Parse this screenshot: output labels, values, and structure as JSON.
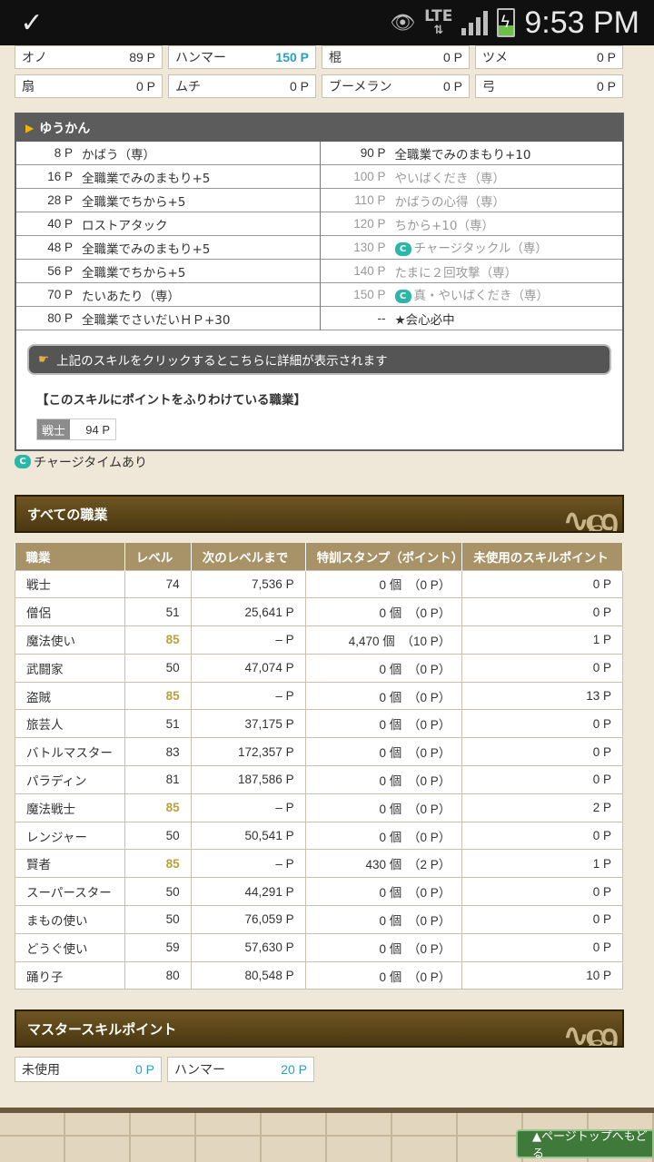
{
  "status_bar": {
    "time": "9:53 PM",
    "network": "LTE"
  },
  "weapons": [
    [
      {
        "name": "オノ",
        "points": "89 P"
      },
      {
        "name": "ハンマー",
        "points": "150 P",
        "highlight": true
      },
      {
        "name": "棍",
        "points": "0 P"
      },
      {
        "name": "ツメ",
        "points": "0 P"
      }
    ],
    [
      {
        "name": "扇",
        "points": "0 P"
      },
      {
        "name": "ムチ",
        "points": "0 P"
      },
      {
        "name": "ブーメラン",
        "points": "0 P"
      },
      {
        "name": "弓",
        "points": "0 P"
      }
    ]
  ],
  "skill_panel": {
    "title": "ゆうかん",
    "left": [
      {
        "p": "8 P",
        "name": "かばう（専）"
      },
      {
        "p": "16 P",
        "name": "全職業でみのまもり+5"
      },
      {
        "p": "28 P",
        "name": "全職業でちから+5"
      },
      {
        "p": "40 P",
        "name": "ロストアタック"
      },
      {
        "p": "48 P",
        "name": "全職業でみのまもり+5"
      },
      {
        "p": "56 P",
        "name": "全職業でちから+5"
      },
      {
        "p": "70 P",
        "name": "たいあたり（専）"
      },
      {
        "p": "80 P",
        "name": "全職業でさいだいＨＰ+30"
      }
    ],
    "right": [
      {
        "p": "90 P",
        "name": "全職業でみのまもり+10"
      },
      {
        "p": "100 P",
        "name": "やいばくだき（専）"
      },
      {
        "p": "110 P",
        "name": "かばうの心得（専）"
      },
      {
        "p": "120 P",
        "name": "ちから+10（専）"
      },
      {
        "p": "130 P",
        "name": "チャージタックル（専）",
        "charge": true
      },
      {
        "p": "140 P",
        "name": "たまに２回攻撃（専）"
      },
      {
        "p": "150 P",
        "name": "真・やいばくだき（専）",
        "charge": true
      },
      {
        "p": "--",
        "name": "★会心必中"
      }
    ],
    "info_text": "上記のスキルをクリックするとこちらに詳細が表示されます",
    "job_points_title": "【このスキルにポイントをふりわけている職業】",
    "job_points": {
      "job": "戦士",
      "points": "94 P"
    }
  },
  "charge_note": "チャージタイムあり",
  "charge_icon_label": "C",
  "jobs_section_title": "すべての職業",
  "jobs_table": {
    "headers": [
      "職業",
      "レベル",
      "次のレベルまで",
      "特訓スタンプ（ポイント）",
      "未使用のスキルポイント"
    ],
    "rows": [
      {
        "job": "戦士",
        "level": "74",
        "next": "7,536 P",
        "stamp": "0 個　（0 P）",
        "unused": "0 P"
      },
      {
        "job": "僧侶",
        "level": "51",
        "next": "25,641 P",
        "stamp": "0 個　（0 P）",
        "unused": "0 P"
      },
      {
        "job": "魔法使い",
        "level": "85",
        "max": true,
        "next": "– P",
        "stamp": "4,470 個　（10 P）",
        "unused": "1 P"
      },
      {
        "job": "武闘家",
        "level": "50",
        "next": "47,074 P",
        "stamp": "0 個　（0 P）",
        "unused": "0 P"
      },
      {
        "job": "盗賊",
        "level": "85",
        "max": true,
        "next": "– P",
        "stamp": "0 個　（0 P）",
        "unused": "13 P"
      },
      {
        "job": "旅芸人",
        "level": "51",
        "next": "37,175 P",
        "stamp": "0 個　（0 P）",
        "unused": "0 P"
      },
      {
        "job": "バトルマスター",
        "level": "83",
        "next": "172,357 P",
        "stamp": "0 個　（0 P）",
        "unused": "0 P"
      },
      {
        "job": "パラディン",
        "level": "81",
        "next": "187,586 P",
        "stamp": "0 個　（0 P）",
        "unused": "0 P"
      },
      {
        "job": "魔法戦士",
        "level": "85",
        "max": true,
        "next": "– P",
        "stamp": "0 個　（0 P）",
        "unused": "2 P"
      },
      {
        "job": "レンジャー",
        "level": "50",
        "next": "50,541 P",
        "stamp": "0 個　（0 P）",
        "unused": "0 P"
      },
      {
        "job": "賢者",
        "level": "85",
        "max": true,
        "next": "– P",
        "stamp": "430 個　（2 P）",
        "unused": "1 P"
      },
      {
        "job": "スーパースター",
        "level": "50",
        "next": "44,291 P",
        "stamp": "0 個　（0 P）",
        "unused": "0 P"
      },
      {
        "job": "まもの使い",
        "level": "50",
        "next": "76,059 P",
        "stamp": "0 個　（0 P）",
        "unused": "0 P"
      },
      {
        "job": "どうぐ使い",
        "level": "59",
        "next": "57,630 P",
        "stamp": "0 個　（0 P）",
        "unused": "0 P"
      },
      {
        "job": "踊り子",
        "level": "80",
        "next": "80,548 P",
        "stamp": "0 個　（0 P）",
        "unused": "10 P"
      }
    ]
  },
  "master_section_title": "マスタースキルポイント",
  "master_points": [
    {
      "name": "未使用",
      "points": "0 P"
    },
    {
      "name": "ハンマー",
      "points": "20 P"
    }
  ],
  "page_top_label": "▲ページトップへもどる",
  "colors": {
    "highlight": "#2a9fc0",
    "max_level": "#b7a13a",
    "charge_icon": "#2bb6a8"
  }
}
